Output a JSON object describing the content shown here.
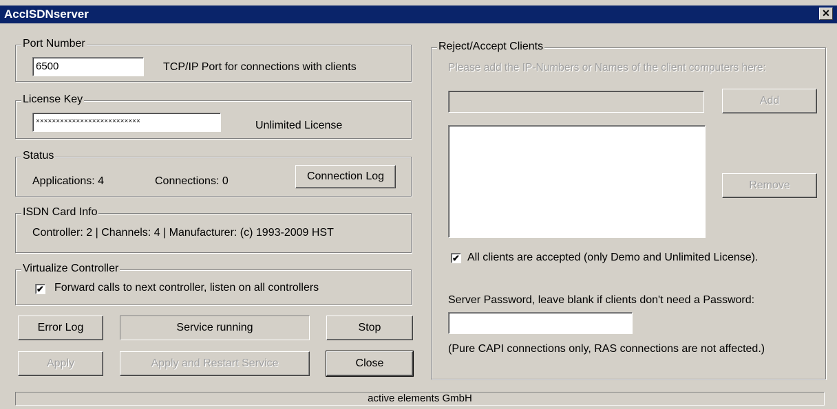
{
  "window": {
    "title": "AccISDNserver",
    "close_glyph": "✕"
  },
  "port": {
    "legend": "Port Number",
    "value": "6500",
    "description": "TCP/IP Port for connections with clients"
  },
  "license": {
    "legend": "License Key",
    "value": "××××××××××××××××××××××××××",
    "type": "Unlimited License"
  },
  "status": {
    "legend": "Status",
    "applications": "Applications: 4",
    "connections": "Connections: 0",
    "connection_log_button": "Connection Log"
  },
  "isdn": {
    "legend": "ISDN Card Info",
    "info": "Controller: 2  |  Channels: 4  |  Manufacturer: (c) 1993-2009 HST"
  },
  "virtualize": {
    "legend": "Virtualize Controller",
    "checkbox_label": "Forward calls to next controller, listen on all controllers",
    "checked": true
  },
  "buttons": {
    "error_log": "Error Log",
    "service_state": "Service running",
    "stop": "Stop",
    "apply": "Apply",
    "apply_restart": "Apply and Restart Service",
    "close": "Close"
  },
  "clients": {
    "legend": "Reject/Accept Clients",
    "hint": "Please add the IP-Numbers or Names of the client computers here:",
    "add_button": "Add",
    "remove_button": "Remove",
    "accept_all_label": "All clients are accepted (only Demo and Unlimited License).",
    "accept_all_checked": true,
    "password_label": "Server Password, leave blank if clients don't need a Password:",
    "password_value": "",
    "note": "(Pure CAPI connections only, RAS connections are not affected.)"
  },
  "statusbar": {
    "text": "active elements GmbH"
  },
  "check_glyph": "✔"
}
